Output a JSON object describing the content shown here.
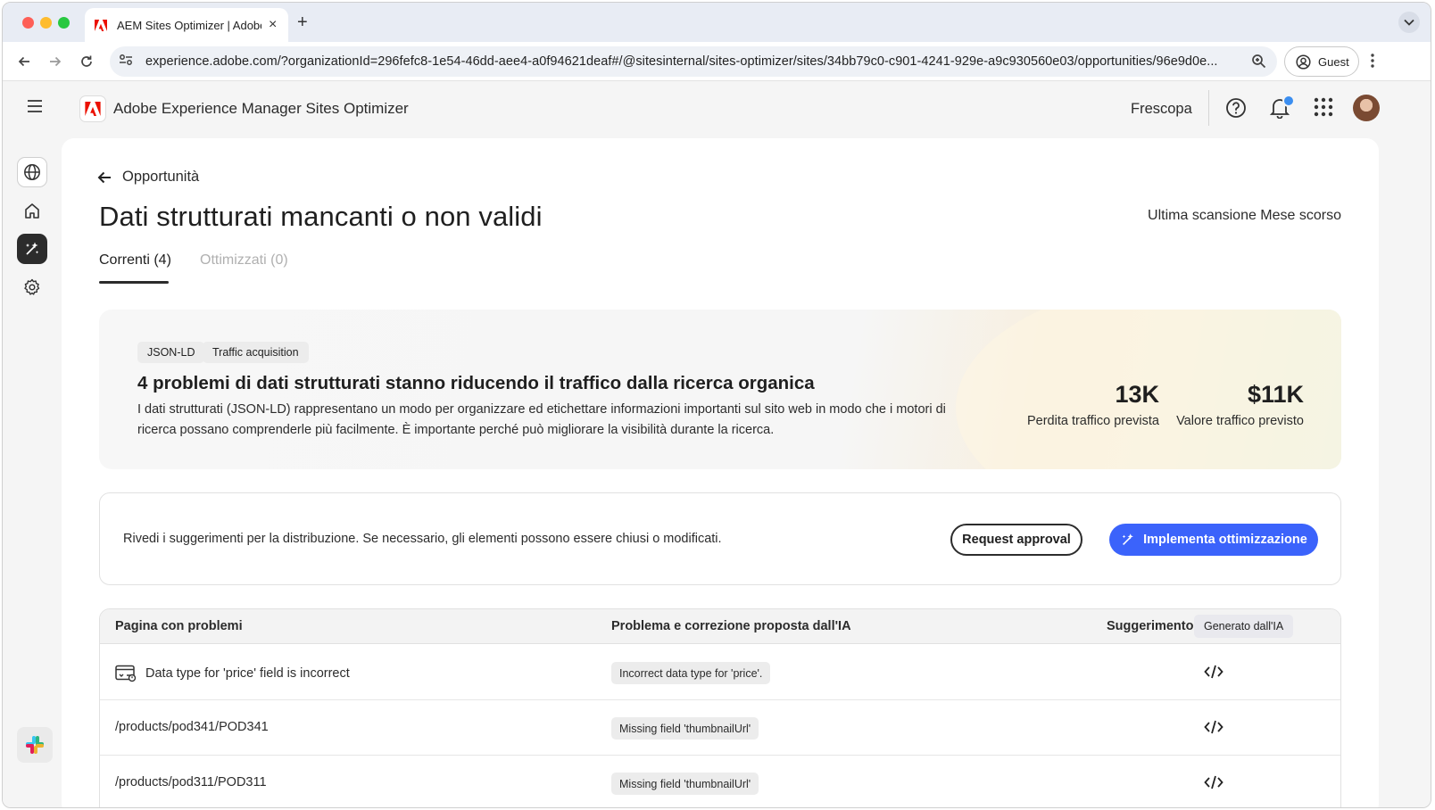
{
  "browser": {
    "tab_title": "AEM Sites Optimizer | Adobe Experience Manager",
    "url": "experience.adobe.com/?organizationId=296fefc8-1e54-46dd-aee4-a0f94621deaf#/@sitesinternal/sites-optimizer/sites/34bb79c0-c901-4241-929e-a9c930560e03/opportunities/96e9d0e...",
    "profile_label": "Guest"
  },
  "app": {
    "title": "Adobe Experience Manager Sites Optimizer",
    "org": "Frescopa"
  },
  "page": {
    "back_label": "Opportunità",
    "title": "Dati strutturati mancanti o non validi",
    "last_scan": "Ultima scansione Mese scorso",
    "tabs": [
      {
        "label": "Correnti (4)",
        "active": true
      },
      {
        "label": "Ottimizzati (0)",
        "active": false
      }
    ]
  },
  "hero": {
    "badges": [
      "JSON-LD",
      "Traffic acquisition"
    ],
    "title": "4 problemi di dati strutturati stanno riducendo il traffico dalla ricerca organica",
    "description": "I dati strutturati (JSON-LD) rappresentano un modo per organizzare ed etichettare informazioni importanti sul sito web in modo che i motori di ricerca possano comprenderle più facilmente. È importante perché può migliorare la visibilità durante la ricerca.",
    "metrics": [
      {
        "value": "13K",
        "label": "Perdita traffico prevista"
      },
      {
        "value": "$11K",
        "label": "Valore traffico previsto"
      }
    ]
  },
  "review": {
    "text": "Rivedi i suggerimenti per la distribuzione. Se necessario, gli elementi possono essere chiusi o modificati.",
    "request_label": "Request approval",
    "deploy_label": "Implementa ottimizzazione"
  },
  "table": {
    "headers": {
      "page": "Pagina con problemi",
      "issue": "Problema e correzione proposta dall'IA",
      "suggestion": "Suggerimento",
      "ai_chip": "Generato dall'IA"
    },
    "rows": [
      {
        "page": "Data type for 'price' field is incorrect",
        "issue": "Incorrect data type for 'price'.",
        "has_icon": true
      },
      {
        "page": "/products/pod341/POD341",
        "issue": "Missing field 'thumbnailUrl'",
        "has_icon": false
      },
      {
        "page": "/products/pod311/POD311",
        "issue": "Missing field 'thumbnailUrl'",
        "has_icon": false
      }
    ]
  },
  "colors": {
    "accent": "#3b63fb",
    "adobe_red": "#eb1000",
    "notification": "#3b8ef0"
  },
  "icons": [
    "adobe-logo-icon",
    "back-arrow-icon",
    "forward-arrow-icon",
    "reload-icon",
    "site-settings-icon",
    "zoom-icon",
    "profile-icon",
    "kebab-icon",
    "hamburger-icon",
    "help-icon",
    "bell-icon",
    "apps-grid-icon",
    "globe-icon",
    "home-icon",
    "opportunities-icon",
    "settings-icon",
    "slack-icon",
    "sparkle-icon",
    "code-icon",
    "page-issue-icon"
  ]
}
